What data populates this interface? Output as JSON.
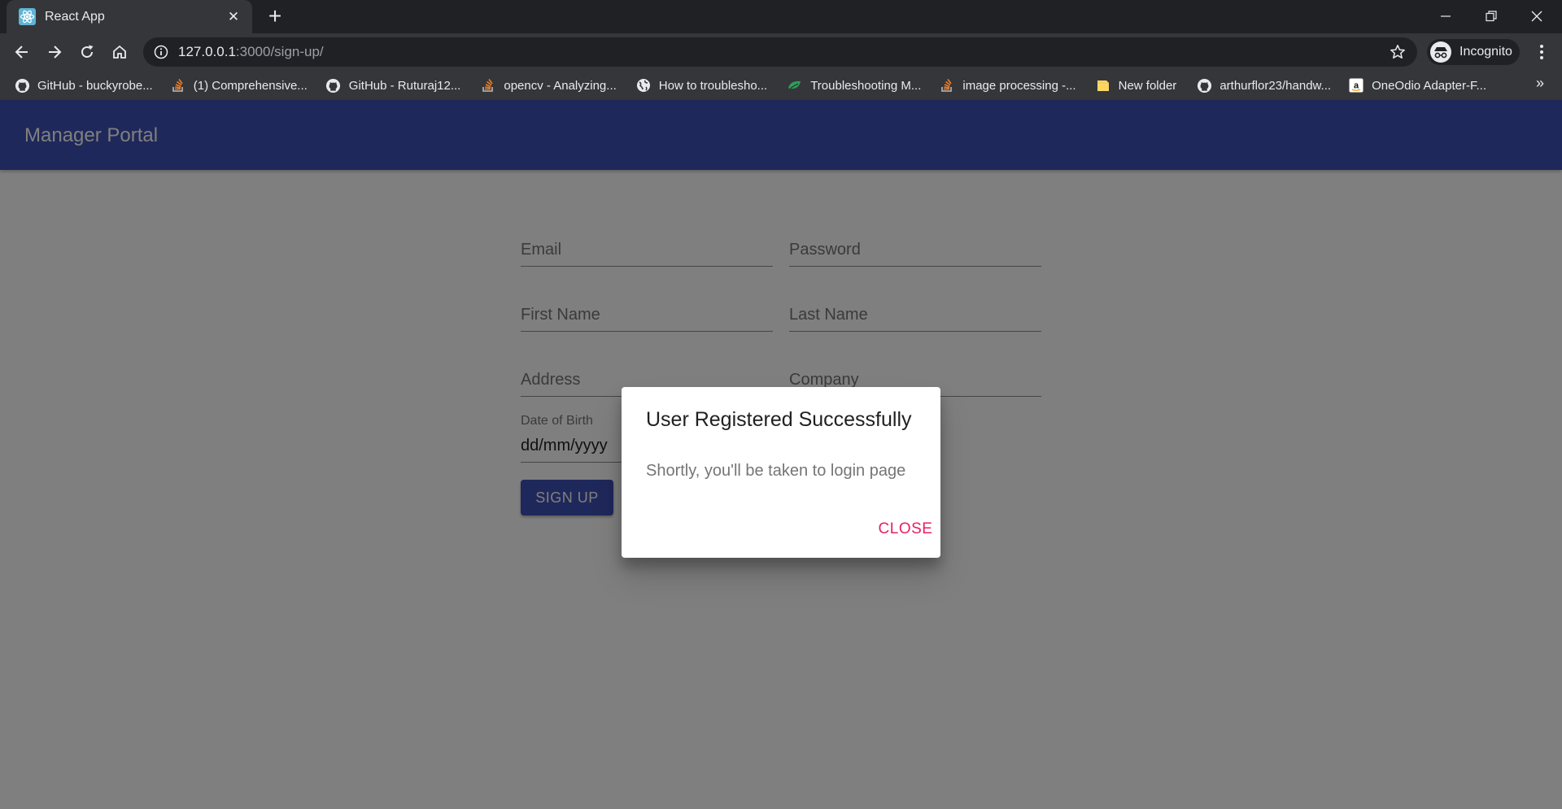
{
  "browser": {
    "tab_title": "React App",
    "url_host": "127.0.0.1",
    "url_rest": ":3000/sign-up/",
    "incognito_label": "Incognito",
    "bookmarks": [
      {
        "icon": "github-icon",
        "label": "GitHub - buckyrobe..."
      },
      {
        "icon": "stackoverflow-icon",
        "label": "(1) Comprehensive..."
      },
      {
        "icon": "github-icon",
        "label": "GitHub - Ruturaj12..."
      },
      {
        "icon": "stackoverflow-icon",
        "label": "opencv - Analyzing..."
      },
      {
        "icon": "globe-icon",
        "label": "How to troublesho..."
      },
      {
        "icon": "leaf-icon",
        "label": "Troubleshooting M..."
      },
      {
        "icon": "stackoverflow-icon",
        "label": "image processing -..."
      },
      {
        "icon": "folder-icon",
        "label": "New folder"
      },
      {
        "icon": "github-icon",
        "label": "arthurflor23/handw..."
      },
      {
        "icon": "amazon-icon",
        "label": "OneOdio Adapter-F..."
      }
    ],
    "more_bookmarks": "»"
  },
  "app": {
    "title": "Manager Portal"
  },
  "form": {
    "email_label": "Email",
    "password_label": "Password",
    "first_name_label": "First Name",
    "last_name_label": "Last Name",
    "address_label": "Address",
    "company_label": "Company",
    "dob_label": "Date of Birth",
    "dob_placeholder": "dd/mm/yyyy",
    "signup_label": "SIGN UP"
  },
  "dialog": {
    "title": "User Registered Successfully",
    "text": "Shortly, you'll be taken to login page",
    "close_label": "CLOSE"
  },
  "colors": {
    "appbar": "#3f51b5",
    "accent": "#e91e63"
  }
}
